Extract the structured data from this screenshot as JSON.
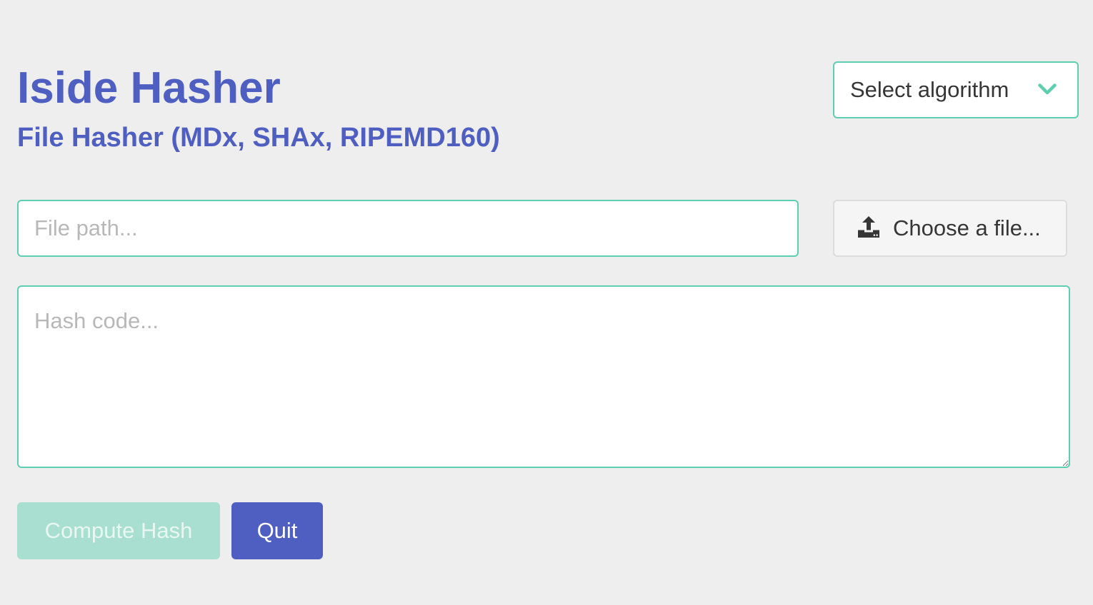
{
  "header": {
    "title": "Iside Hasher",
    "subtitle": "File Hasher (MDx, SHAx, RIPEMD160)"
  },
  "algorithm_select": {
    "selected_label": "Select algorithm",
    "icon": "chevron-down-icon"
  },
  "file_path": {
    "value": "",
    "placeholder": "File path..."
  },
  "file_button": {
    "label": "Choose a file...",
    "icon": "upload-icon"
  },
  "hash_output": {
    "value": "",
    "placeholder": "Hash code..."
  },
  "actions": {
    "compute_label": "Compute Hash",
    "quit_label": "Quit"
  },
  "colors": {
    "primary": "#4f5fc1",
    "accent": "#5dcfb0",
    "compute_disabled": "#a8dfd1",
    "background": "#eeeeee"
  }
}
